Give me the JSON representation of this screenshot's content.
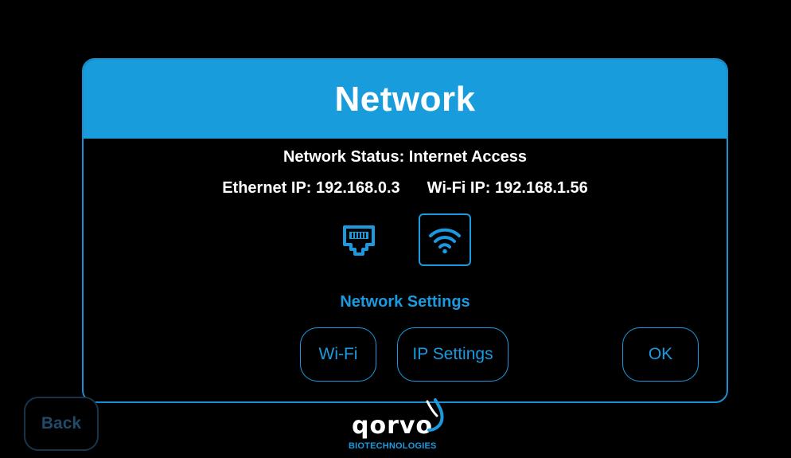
{
  "back_button": {
    "label": "Back"
  },
  "dialog": {
    "title": "Network",
    "status_text": "Network Status: Internet Access",
    "ethernet_ip": "Ethernet IP:  192.168.0.3",
    "wifi_ip": "Wi-Fi IP:  192.168.1.56",
    "icons": [
      "ethernet-icon",
      "wifi-icon"
    ],
    "settings_heading": "Network Settings",
    "buttons": {
      "wifi": "Wi-Fi",
      "ip_settings": "IP Settings",
      "ok": "OK"
    }
  },
  "logo": {
    "word": "qorvo",
    "subtitle": "BIOTECHNOLOGIES"
  },
  "colors": {
    "accent": "#199cdb",
    "background": "#000000",
    "text": "#ffffff",
    "back_button_text": "#1f4a69"
  }
}
